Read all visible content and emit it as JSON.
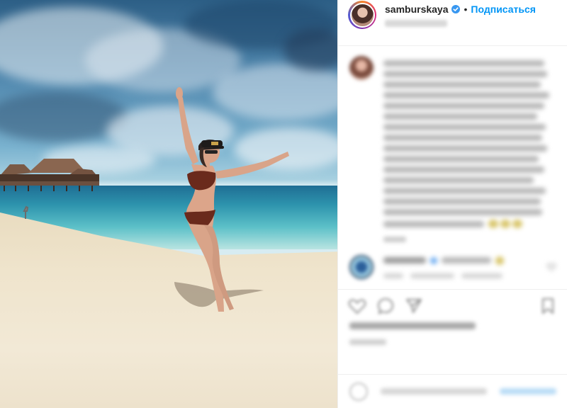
{
  "post": {
    "header": {
      "username": "samburskaya",
      "separator": "•",
      "follow_label": "Подписаться"
    },
    "icons": {
      "verified": "verified-badge-icon",
      "like": "heart-icon",
      "comment": "comment-bubble-icon",
      "share": "share-plane-icon",
      "save": "bookmark-icon",
      "emoji": "emoji-icon"
    },
    "colors": {
      "follow": "#0095f6",
      "verified": "#3897f0",
      "text": "#262626",
      "border": "#efefef"
    }
  }
}
